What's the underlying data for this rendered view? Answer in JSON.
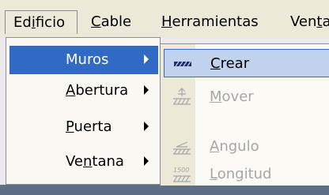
{
  "menubar": {
    "items": [
      {
        "pre": "Ed",
        "u": "i",
        "post": "ficio"
      },
      {
        "pre": "",
        "u": "C",
        "post": "able"
      },
      {
        "pre": "",
        "u": "H",
        "post": "erramientas"
      },
      {
        "pre": "Ven",
        "u": "t",
        "post": "a"
      }
    ]
  },
  "edificio_menu": {
    "items": [
      {
        "pre": "Muros",
        "u": "",
        "post": ""
      },
      {
        "pre": "",
        "u": "A",
        "post": "bertura"
      },
      {
        "pre": "",
        "u": "P",
        "post": "uerta"
      },
      {
        "pre": "Ve",
        "u": "n",
        "post": "tana"
      }
    ]
  },
  "muros_submenu": {
    "items": [
      {
        "pre": "",
        "u": "C",
        "post": "rear",
        "icon": "wall-icon",
        "state": "highlighted"
      },
      {
        "pre": "",
        "u": "M",
        "post": "over",
        "icon": "move-wall-icon",
        "state": "disabled"
      },
      {
        "pre": "",
        "u": "A",
        "post": "ngulo",
        "icon": "angle-wall-icon",
        "state": "disabled"
      },
      {
        "pre": "",
        "u": "L",
        "post": "ongitud",
        "icon": "length-wall-icon",
        "icon_text": "1500",
        "state": "disabled"
      }
    ]
  },
  "colors": {
    "highlight": "#316ac5",
    "submenu_highlight": "#c1d2ee",
    "disabled_text": "#a6a6a6"
  }
}
